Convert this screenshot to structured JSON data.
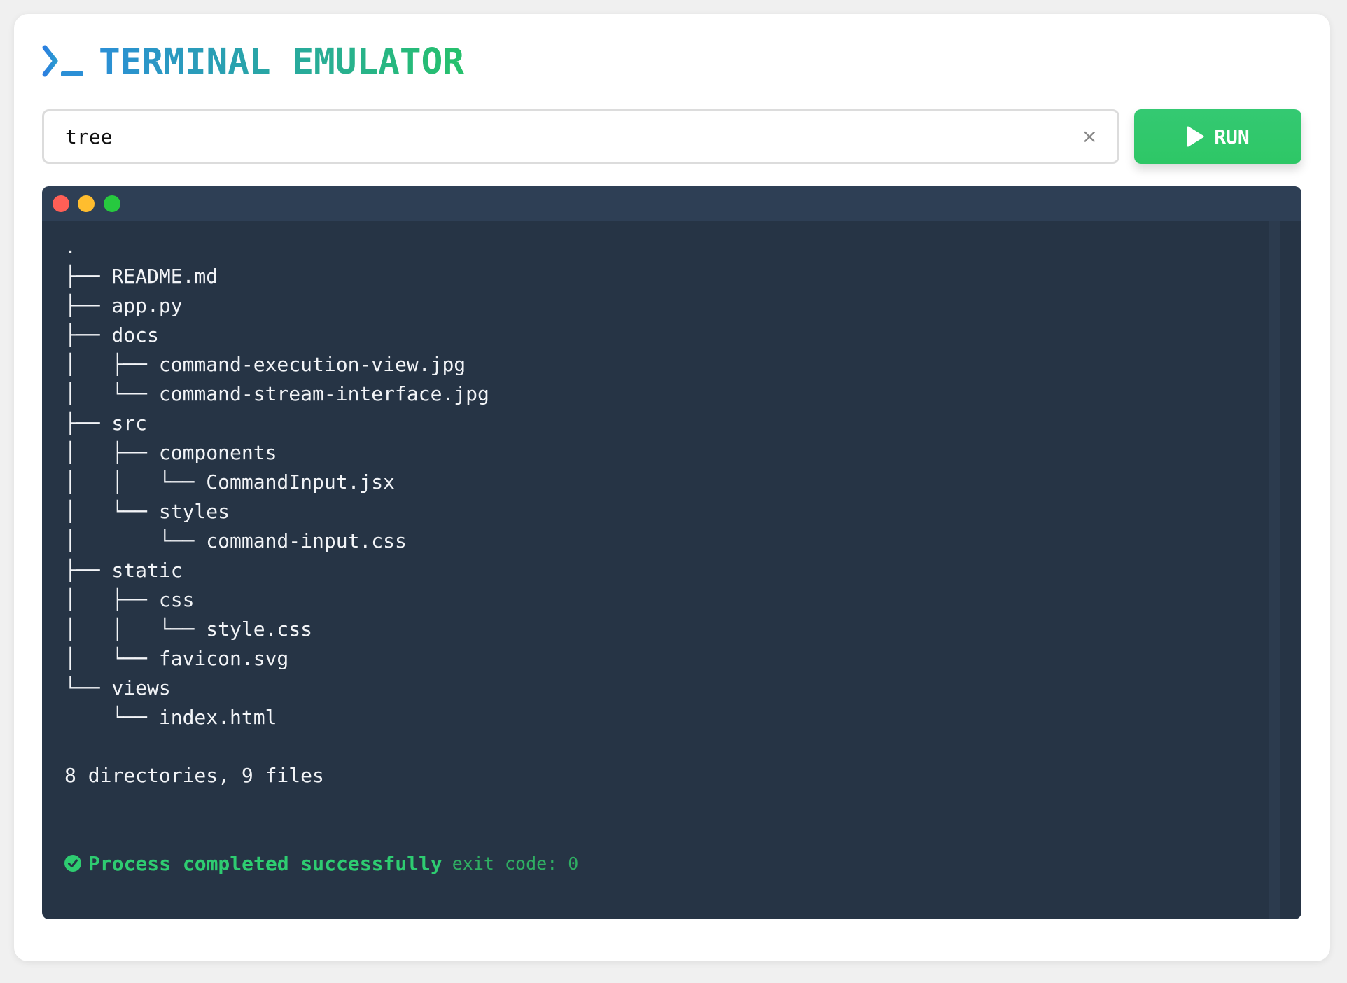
{
  "header": {
    "title": "TERMINAL EMULATOR",
    "icon": "terminal-prompt-icon"
  },
  "command": {
    "value": "tree",
    "placeholder": "",
    "clear_label": "×",
    "run_label": "RUN"
  },
  "colors": {
    "accent_blue": "#2b8fd6",
    "accent_green": "#2ecc71",
    "terminal_bg": "#263445",
    "terminal_header": "#2e3f55"
  },
  "terminal": {
    "window_dots": [
      "#ff5f56",
      "#ffbd2e",
      "#27c93f"
    ],
    "output_lines": [
      ".",
      "├── README.md",
      "├── app.py",
      "├── docs",
      "│   ├── command-execution-view.jpg",
      "│   └── command-stream-interface.jpg",
      "├── src",
      "│   ├── components",
      "│   │   └── CommandInput.jsx",
      "│   └── styles",
      "│       └── command-input.css",
      "├── static",
      "│   ├── css",
      "│   │   └── style.css",
      "│   └── favicon.svg",
      "└── views",
      "    └── index.html"
    ],
    "summary": "8 directories, 9 files",
    "status": {
      "text": "Process completed successfully",
      "exit_code": "exit code: 0",
      "icon": "check-circle-icon"
    }
  }
}
